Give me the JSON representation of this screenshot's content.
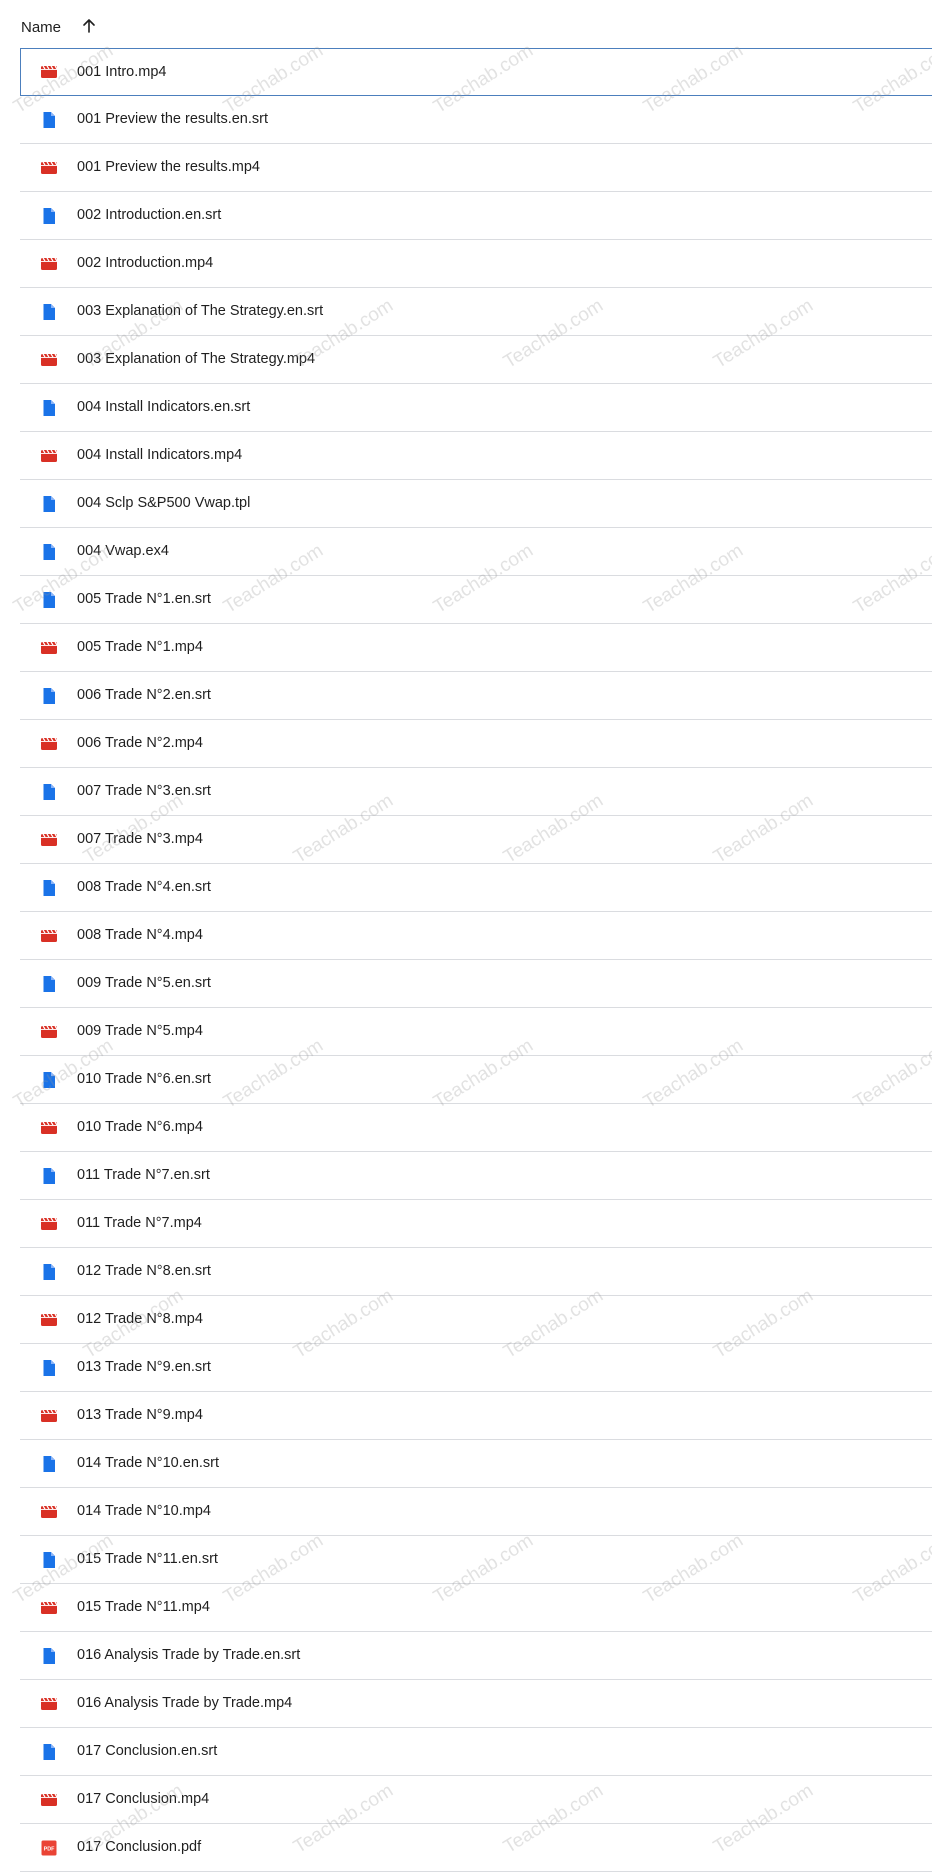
{
  "header": {
    "name_label": "Name"
  },
  "icons": {
    "video": "video-file-icon",
    "doc": "document-file-icon",
    "pdf": "pdf-file-icon",
    "sort": "arrow-up-icon"
  },
  "colors": {
    "video": "#d93025",
    "doc": "#1a73e8",
    "pdf": "#ea4335",
    "selected_border": "#4c7fbd",
    "divider": "#dadce0"
  },
  "watermark_text": "Teachab.com",
  "files": [
    {
      "name": "001 Intro.mp4",
      "type": "video",
      "selected": true
    },
    {
      "name": "001 Preview the results.en.srt",
      "type": "doc"
    },
    {
      "name": "001 Preview the results.mp4",
      "type": "video"
    },
    {
      "name": "002 Introduction.en.srt",
      "type": "doc"
    },
    {
      "name": "002 Introduction.mp4",
      "type": "video"
    },
    {
      "name": "003 Explanation of The Strategy.en.srt",
      "type": "doc"
    },
    {
      "name": "003 Explanation of The Strategy.mp4",
      "type": "video"
    },
    {
      "name": "004 Install Indicators.en.srt",
      "type": "doc"
    },
    {
      "name": "004 Install Indicators.mp4",
      "type": "video"
    },
    {
      "name": "004 Sclp S&P500 Vwap.tpl",
      "type": "doc"
    },
    {
      "name": "004 Vwap.ex4",
      "type": "doc"
    },
    {
      "name": "005 Trade N°1.en.srt",
      "type": "doc"
    },
    {
      "name": "005 Trade N°1.mp4",
      "type": "video"
    },
    {
      "name": "006 Trade N°2.en.srt",
      "type": "doc"
    },
    {
      "name": "006 Trade N°2.mp4",
      "type": "video"
    },
    {
      "name": "007 Trade N°3.en.srt",
      "type": "doc"
    },
    {
      "name": "007 Trade N°3.mp4",
      "type": "video"
    },
    {
      "name": "008 Trade N°4.en.srt",
      "type": "doc"
    },
    {
      "name": "008 Trade N°4.mp4",
      "type": "video"
    },
    {
      "name": "009 Trade N°5.en.srt",
      "type": "doc"
    },
    {
      "name": "009 Trade N°5.mp4",
      "type": "video"
    },
    {
      "name": "010 Trade N°6.en.srt",
      "type": "doc"
    },
    {
      "name": "010 Trade N°6.mp4",
      "type": "video"
    },
    {
      "name": "011 Trade N°7.en.srt",
      "type": "doc"
    },
    {
      "name": "011 Trade N°7.mp4",
      "type": "video"
    },
    {
      "name": "012 Trade N°8.en.srt",
      "type": "doc"
    },
    {
      "name": "012 Trade N°8.mp4",
      "type": "video"
    },
    {
      "name": "013 Trade N°9.en.srt",
      "type": "doc"
    },
    {
      "name": "013 Trade N°9.mp4",
      "type": "video"
    },
    {
      "name": "014 Trade N°10.en.srt",
      "type": "doc"
    },
    {
      "name": "014 Trade N°10.mp4",
      "type": "video"
    },
    {
      "name": "015 Trade N°11.en.srt",
      "type": "doc"
    },
    {
      "name": "015 Trade N°11.mp4",
      "type": "video"
    },
    {
      "name": "016 Analysis Trade by Trade.en.srt",
      "type": "doc"
    },
    {
      "name": "016 Analysis Trade by Trade.mp4",
      "type": "video"
    },
    {
      "name": "017 Conclusion.en.srt",
      "type": "doc"
    },
    {
      "name": "017 Conclusion.mp4",
      "type": "video"
    },
    {
      "name": "017 Conclusion.pdf",
      "type": "pdf"
    }
  ]
}
